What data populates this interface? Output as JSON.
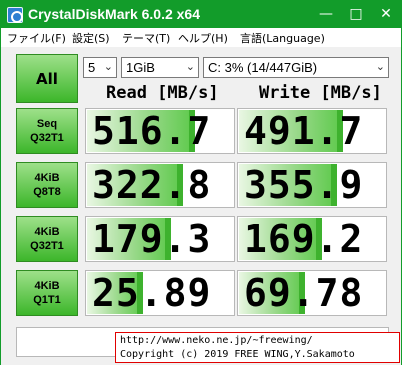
{
  "window": {
    "title": "CrystalDiskMark 6.0.2 x64",
    "title_bar_color": "#129c2a",
    "controls": {
      "minimize_icon": "minimize-icon",
      "maximize_icon": "maximize-icon",
      "close_icon": "close-icon"
    }
  },
  "menu": [
    "ファイル(F)",
    "設定(S)",
    "テーマ(T)",
    "ヘルプ(H)",
    "言語(Language)"
  ],
  "controls": {
    "all_label": "All",
    "test_count": "5",
    "test_size": "1GiB",
    "drive": "C: 3% (14/447GiB)"
  },
  "headers": {
    "read": "Read [MB/s]",
    "write": "Write [MB/s]"
  },
  "tests": [
    {
      "line1": "Seq",
      "line2": "Q32T1",
      "read": "516.7",
      "write": "491.7"
    },
    {
      "line1": "4KiB",
      "line2": "Q8T8",
      "read": "322.8",
      "write": "355.9"
    },
    {
      "line1": "4KiB",
      "line2": "Q32T1",
      "read": "179.3",
      "write": "169.2"
    },
    {
      "line1": "4KiB",
      "line2": "Q1T1",
      "read": "25.89",
      "write": "69.78"
    }
  ],
  "comment": "",
  "credit": {
    "url": "http://www.neko.ne.jp/~freewing/",
    "copyright": "Copyright (c) 2019 FREE WING,Y.Sakamoto"
  },
  "colors": {
    "accent": "#129c2a",
    "button_green": "#3cb62a",
    "credit_border": "#e00000"
  }
}
